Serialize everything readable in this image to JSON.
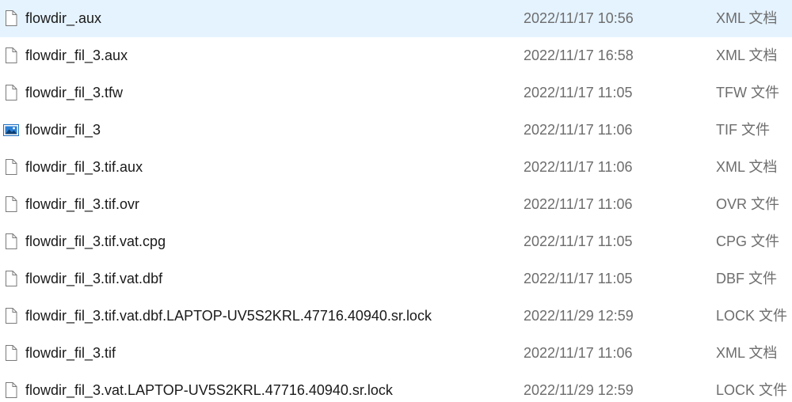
{
  "files": [
    {
      "name": "flowdir_.aux",
      "modified": "2022/11/17 10:56",
      "type": "XML 文档",
      "icon": "document-icon"
    },
    {
      "name": "flowdir_fil_3.aux",
      "modified": "2022/11/17 16:58",
      "type": "XML 文档",
      "icon": "document-icon"
    },
    {
      "name": "flowdir_fil_3.tfw",
      "modified": "2022/11/17 11:05",
      "type": "TFW 文件",
      "icon": "document-icon"
    },
    {
      "name": "flowdir_fil_3",
      "modified": "2022/11/17 11:06",
      "type": "TIF 文件",
      "icon": "image-icon"
    },
    {
      "name": "flowdir_fil_3.tif.aux",
      "modified": "2022/11/17 11:06",
      "type": "XML 文档",
      "icon": "document-icon"
    },
    {
      "name": "flowdir_fil_3.tif.ovr",
      "modified": "2022/11/17 11:06",
      "type": "OVR 文件",
      "icon": "document-icon"
    },
    {
      "name": "flowdir_fil_3.tif.vat.cpg",
      "modified": "2022/11/17 11:05",
      "type": "CPG 文件",
      "icon": "document-icon"
    },
    {
      "name": "flowdir_fil_3.tif.vat.dbf",
      "modified": "2022/11/17 11:05",
      "type": "DBF 文件",
      "icon": "document-icon"
    },
    {
      "name": "flowdir_fil_3.tif.vat.dbf.LAPTOP-UV5S2KRL.47716.40940.sr.lock",
      "modified": "2022/11/29 12:59",
      "type": "LOCK 文件",
      "icon": "document-icon"
    },
    {
      "name": "flowdir_fil_3.tif",
      "modified": "2022/11/17 11:06",
      "type": "XML 文档",
      "icon": "document-icon"
    },
    {
      "name": "flowdir_fil_3.vat.LAPTOP-UV5S2KRL.47716.40940.sr.lock",
      "modified": "2022/11/29 12:59",
      "type": "LOCK 文件",
      "icon": "document-icon"
    }
  ]
}
